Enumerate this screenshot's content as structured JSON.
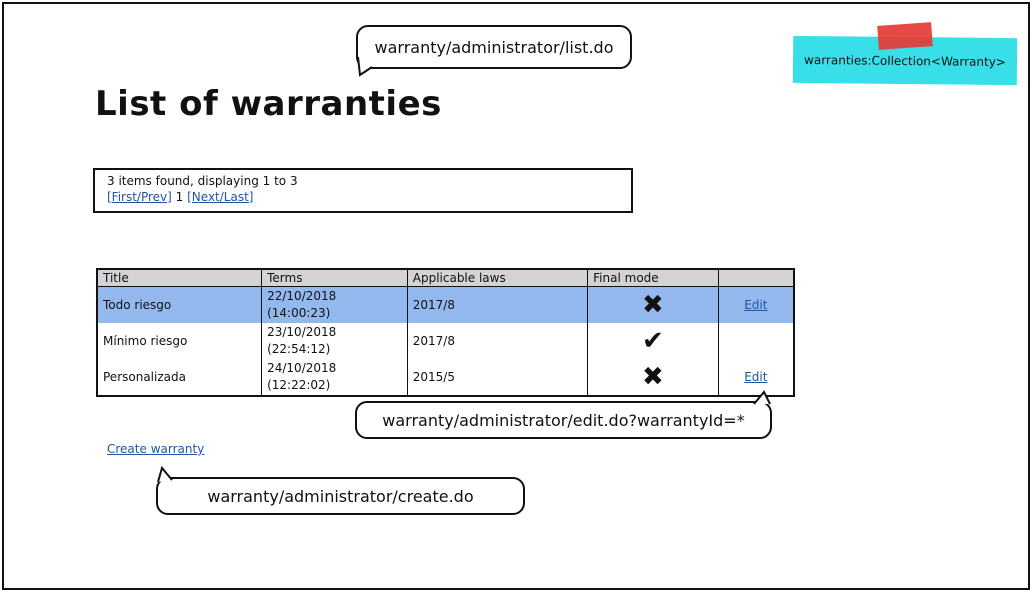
{
  "bubbles": {
    "list_url": "warranty/administrator/list.do",
    "edit_url": "warranty/administrator/edit.do?warrantyId=*",
    "create_url": "warranty/administrator/create.do"
  },
  "sticky_note": "warranties:Collection<Warranty>",
  "page_title": "List of warranties",
  "pager": {
    "summary": "3 items found, displaying 1 to 3",
    "first_prev": "[First/Prev]",
    "current": " 1 ",
    "next_last": "[Next/Last]"
  },
  "table": {
    "headers": [
      "Title",
      "Terms",
      "Applicable laws",
      "Final mode",
      ""
    ],
    "rows": [
      {
        "title": "Todo riesgo",
        "terms_date": "22/10/2018",
        "terms_time": "(14:00:23)",
        "laws": "2017/8",
        "final_mode": "✖",
        "edit": "Edit"
      },
      {
        "title": "Mínimo riesgo",
        "terms_date": "23/10/2018",
        "terms_time": "(22:54:12)",
        "laws": "2017/8",
        "final_mode": "✔",
        "edit": ""
      },
      {
        "title": "Personalizada",
        "terms_date": "24/10/2018",
        "terms_time": "(12:22:02)",
        "laws": "2015/5",
        "final_mode": "✖",
        "edit": "Edit"
      }
    ]
  },
  "create_link": "Create warranty",
  "colors": {
    "selected_row": "#93b8ee",
    "header_bg": "#d3d3d3",
    "link": "#2455a4",
    "sticky": "#39dfe8",
    "tape": "#e53935"
  }
}
